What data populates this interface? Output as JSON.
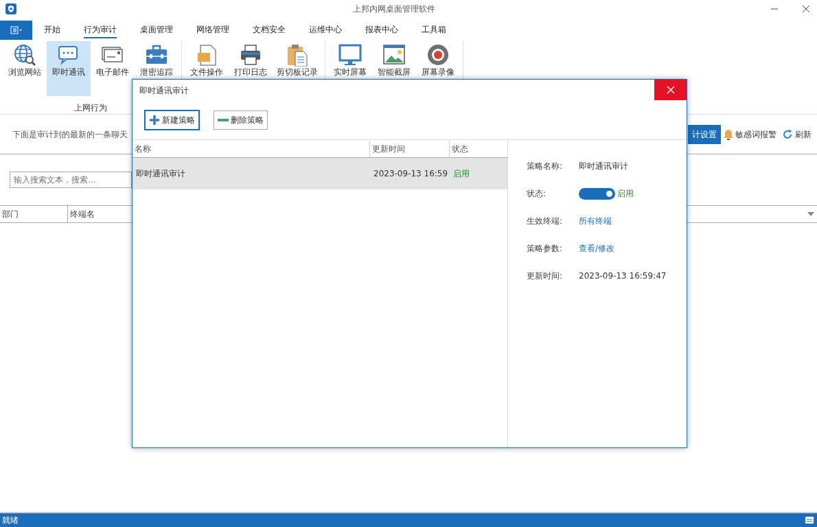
{
  "window": {
    "title": "上邦内网桌面管理软件"
  },
  "menu_tabs": [
    {
      "label": "开始",
      "selected": false
    },
    {
      "label": "行为审计",
      "selected": true
    },
    {
      "label": "桌面管理",
      "selected": false
    },
    {
      "label": "网络管理",
      "selected": false
    },
    {
      "label": "文档安全",
      "selected": false
    },
    {
      "label": "运维中心",
      "selected": false
    },
    {
      "label": "报表中心",
      "selected": false
    },
    {
      "label": "工具箱",
      "selected": false
    }
  ],
  "ribbon_groups": [
    {
      "label": "上网行为",
      "items": [
        {
          "kind": "globe",
          "label": "浏览网站",
          "selected": false
        },
        {
          "kind": "chat",
          "label": "即时通讯",
          "selected": true
        },
        {
          "kind": "mail",
          "label": "电子邮件",
          "selected": false
        },
        {
          "kind": "case",
          "label": "泄密追踪",
          "selected": false
        }
      ]
    },
    {
      "items": [
        {
          "kind": "file",
          "label": "文件操作",
          "selected": false
        },
        {
          "kind": "printer",
          "label": "打印日志",
          "selected": false
        },
        {
          "kind": "clipboard",
          "label": "剪切板记录",
          "selected": false
        }
      ]
    },
    {
      "items": [
        {
          "kind": "monitor",
          "label": "实时屏幕",
          "selected": false
        },
        {
          "kind": "image",
          "label": "智能截屏",
          "selected": false
        },
        {
          "kind": "record",
          "label": "屏幕录像",
          "selected": false
        }
      ]
    }
  ],
  "info_text": "下面是审计到的最新的一条聊天",
  "actions": [
    {
      "kind": "primary",
      "label": "计设置"
    },
    {
      "kind": "bell",
      "label": "敏感词报警"
    },
    {
      "kind": "refresh",
      "label": "刷新"
    }
  ],
  "search": {
    "placeholder": "输入搜索文本，搜索..."
  },
  "table": {
    "columns": [
      "部门",
      "终端名"
    ]
  },
  "status_bar": "就绪",
  "dialog": {
    "title": "即时通讯审计",
    "buttons": [
      {
        "kind": "add",
        "label": "新建策略"
      },
      {
        "kind": "remove",
        "label": "删除策略"
      }
    ],
    "columns": [
      "名称",
      "更新时间",
      "状态"
    ],
    "rows": [
      {
        "name": "即时通讯审计",
        "time": "2023-09-13 16:59",
        "status": "启用",
        "selected": true
      }
    ],
    "details": [
      {
        "kind": "text",
        "label": "策略名称:",
        "value": "即时通讯审计"
      },
      {
        "kind": "switch",
        "label": "状态:",
        "value": "启用",
        "on": true
      },
      {
        "kind": "link",
        "label": "生效终端:",
        "value": "所有终端"
      },
      {
        "kind": "link",
        "label": "策略参数:",
        "value": "查看/修改"
      },
      {
        "kind": "text",
        "label": "更新时间:",
        "value": "2023-09-13 16:59:47"
      }
    ]
  }
}
